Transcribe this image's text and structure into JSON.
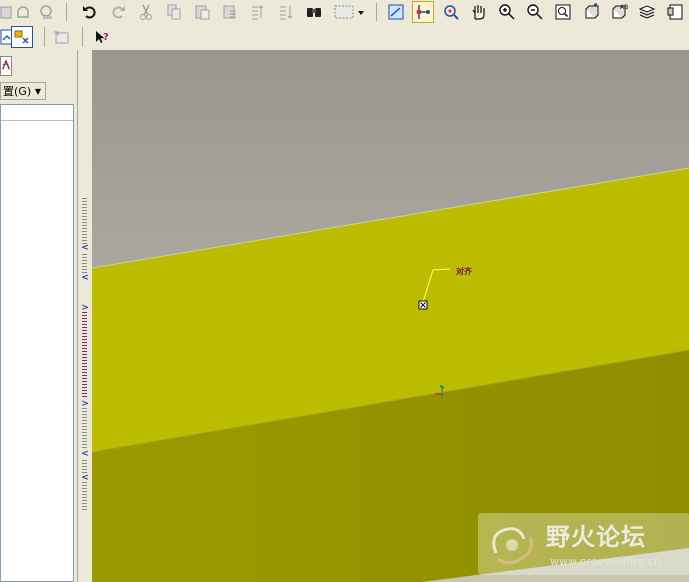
{
  "toolbar": {
    "row1_icons": [
      "open-icon",
      "save-icon",
      "print-icon",
      "undo-icon",
      "redo-icon",
      "cut-icon",
      "copy-icon",
      "paste-icon",
      "paste-special-icon",
      "regenerate-icon",
      "regenerate-manager-icon",
      "find-icon",
      "selection-box-icon",
      "dropdown-arrow-icon",
      "plane-display-icon",
      "axis-display-icon",
      "point-display-icon",
      "spin-center-icon",
      "zoom-in-icon",
      "zoom-out-icon",
      "refit-icon",
      "orient-icon",
      "saved-views-icon",
      "layers-icon",
      "model-tree-icon"
    ],
    "row2_icons": [
      "model-display-icon",
      "datum-display-icon",
      "sketch-icon",
      "whats-this-icon"
    ]
  },
  "left_panel": {
    "settings_label": "置(G)",
    "settings_arrow": "▼"
  },
  "canvas": {
    "datum_label": "对齐",
    "colors": {
      "background_top": "#9a978e",
      "background_bottom": "#c4c3b7",
      "surface_top": "#bcbc00",
      "surface_bottom": "#939300",
      "surface_edge": "#d0d0a0"
    }
  },
  "watermark": {
    "title": "野火论坛",
    "url": "www.proewildfire.cn"
  }
}
